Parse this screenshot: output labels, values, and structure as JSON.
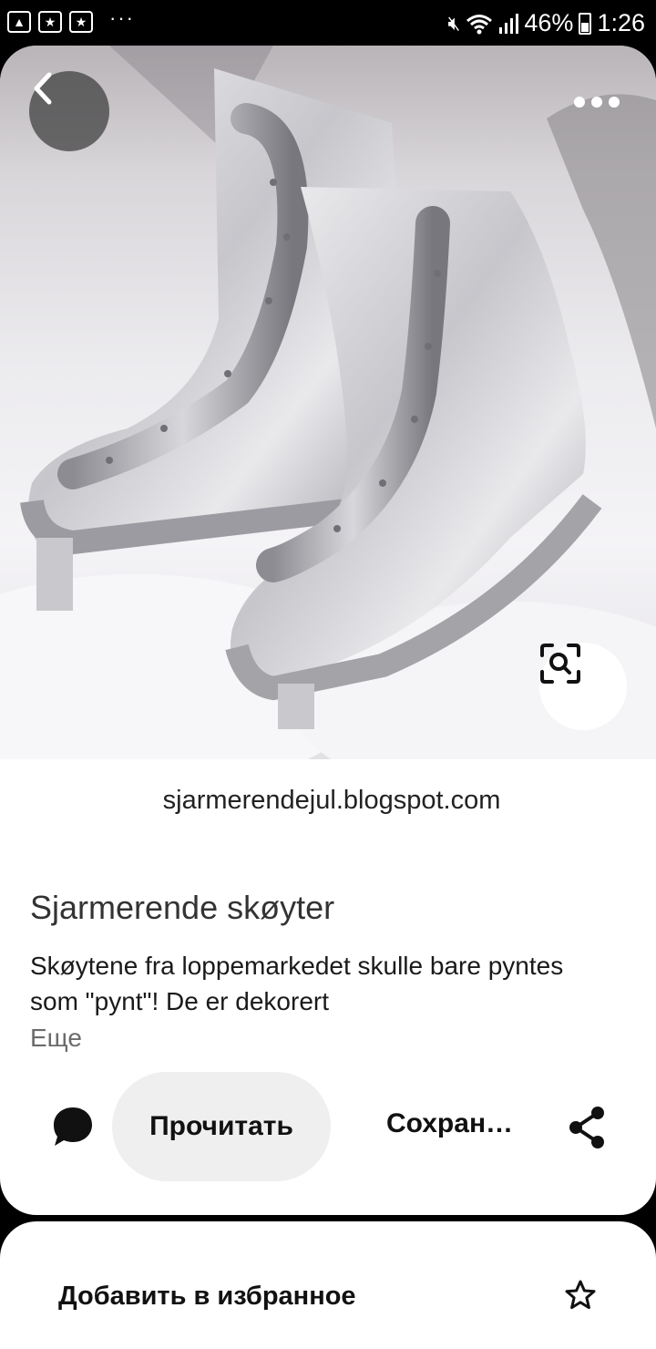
{
  "status_bar": {
    "notification_icons": [
      "image-icon",
      "star-badge-icon",
      "star-badge-icon"
    ],
    "overflow": "···",
    "battery": "46%",
    "time": "1:26"
  },
  "pin": {
    "source": "sjarmerendejul.blogspot.com",
    "title": "Sjarmerende skøyter",
    "description": "Skøytene fra loppemarkedet skulle bare pyntes som \"pynt\"! De er dekorert",
    "more_label": "Еще",
    "read_label": "Прочитать",
    "save_label": "Сохран…"
  },
  "sheet": {
    "favorite_label": "Добавить в избранное"
  }
}
